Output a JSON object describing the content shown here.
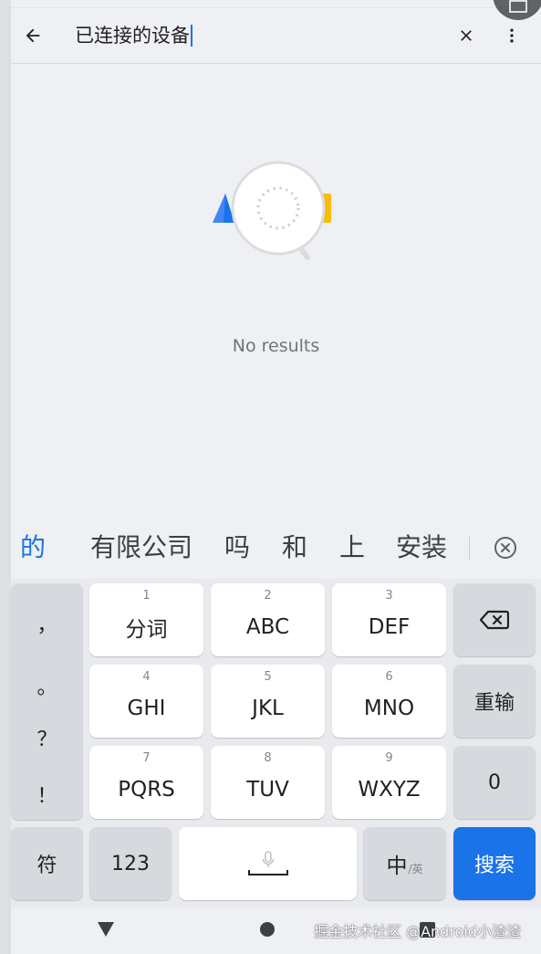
{
  "search": {
    "query": "已连接的设备"
  },
  "empty_state": {
    "message": "No results"
  },
  "candidates": {
    "primary": "的",
    "items": [
      "有限公司",
      "吗",
      "和",
      "上",
      "安装"
    ]
  },
  "keyboard": {
    "punctuation": [
      "，",
      "。",
      "？",
      "！"
    ],
    "keys": {
      "k1": {
        "num": "1",
        "label": "分词"
      },
      "k2": {
        "num": "2",
        "label": "ABC"
      },
      "k3": {
        "num": "3",
        "label": "DEF"
      },
      "k4": {
        "num": "4",
        "label": "GHI"
      },
      "k5": {
        "num": "5",
        "label": "JKL"
      },
      "k6": {
        "num": "6",
        "label": "MNO"
      },
      "k7": {
        "num": "7",
        "label": "PQRS"
      },
      "k8": {
        "num": "8",
        "label": "TUV"
      },
      "k9": {
        "num": "9",
        "label": "WXYZ"
      },
      "zero": "0",
      "reenter": "重输",
      "symbols": "符",
      "numbers": "123",
      "lang_main": "中",
      "lang_alt": "/英",
      "search": "搜索"
    }
  },
  "watermark": "掘金技术社区 @Android小渣渣",
  "colors": {
    "accent": "#1a73e8",
    "background": "#eef0f3",
    "key": "#ffffff",
    "function_key": "#d6dade"
  }
}
